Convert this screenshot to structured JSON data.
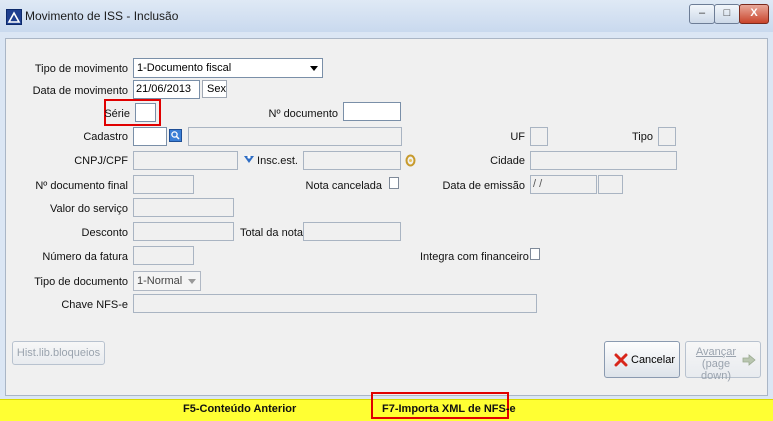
{
  "window": {
    "title": "Movimento de ISS - Inclusão",
    "minimize": "–",
    "maximize": "□",
    "close": "X"
  },
  "form": {
    "tipo_movimento": {
      "label": "Tipo de movimento",
      "value": "1-Documento fiscal"
    },
    "data_movimento": {
      "label": "Data de movimento",
      "value": "21/06/2013",
      "weekday": "Sex"
    },
    "serie": {
      "label": "Série",
      "value": ""
    },
    "num_documento": {
      "label": "Nº documento",
      "value": ""
    },
    "cadastro": {
      "label": "Cadastro",
      "value": "",
      "name_value": ""
    },
    "uf": {
      "label": "UF",
      "value": ""
    },
    "tipo": {
      "label": "Tipo",
      "value": ""
    },
    "cnpj": {
      "label": "CNPJ/CPF",
      "value": ""
    },
    "insc_est": {
      "label": "Insc.est.",
      "value": ""
    },
    "cidade": {
      "label": "Cidade",
      "value": ""
    },
    "num_documento_final": {
      "label": "Nº documento final",
      "value": ""
    },
    "nota_cancelada": {
      "label": "Nota cancelada",
      "checked": false
    },
    "data_emissao": {
      "label": "Data de emissão",
      "value": " / /",
      "extra": ""
    },
    "valor_servico": {
      "label": "Valor do serviço",
      "value": ""
    },
    "desconto": {
      "label": "Desconto",
      "value": ""
    },
    "total_nota": {
      "label": "Total da nota",
      "value": ""
    },
    "numero_fatura": {
      "label": "Número da fatura",
      "value": ""
    },
    "integra_financeiro": {
      "label": "Integra com financeiro",
      "checked": false
    },
    "tipo_documento": {
      "label": "Tipo de documento",
      "value": "1-Normal"
    },
    "chave_nfse": {
      "label": "Chave NFS-e",
      "value": ""
    }
  },
  "buttons": {
    "hist": "Hist.lib.bloqueios",
    "cancelar": "Cancelar",
    "avancar_line1": "Avançar",
    "avancar_line2": "(page down)"
  },
  "statusbar": {
    "f5": "F5-Conteúdo Anterior",
    "f7": "F7-Importa XML de NFS-e"
  },
  "colors": {
    "highlight_red": "#e00000",
    "statusbar_yellow": "#ffff33"
  }
}
